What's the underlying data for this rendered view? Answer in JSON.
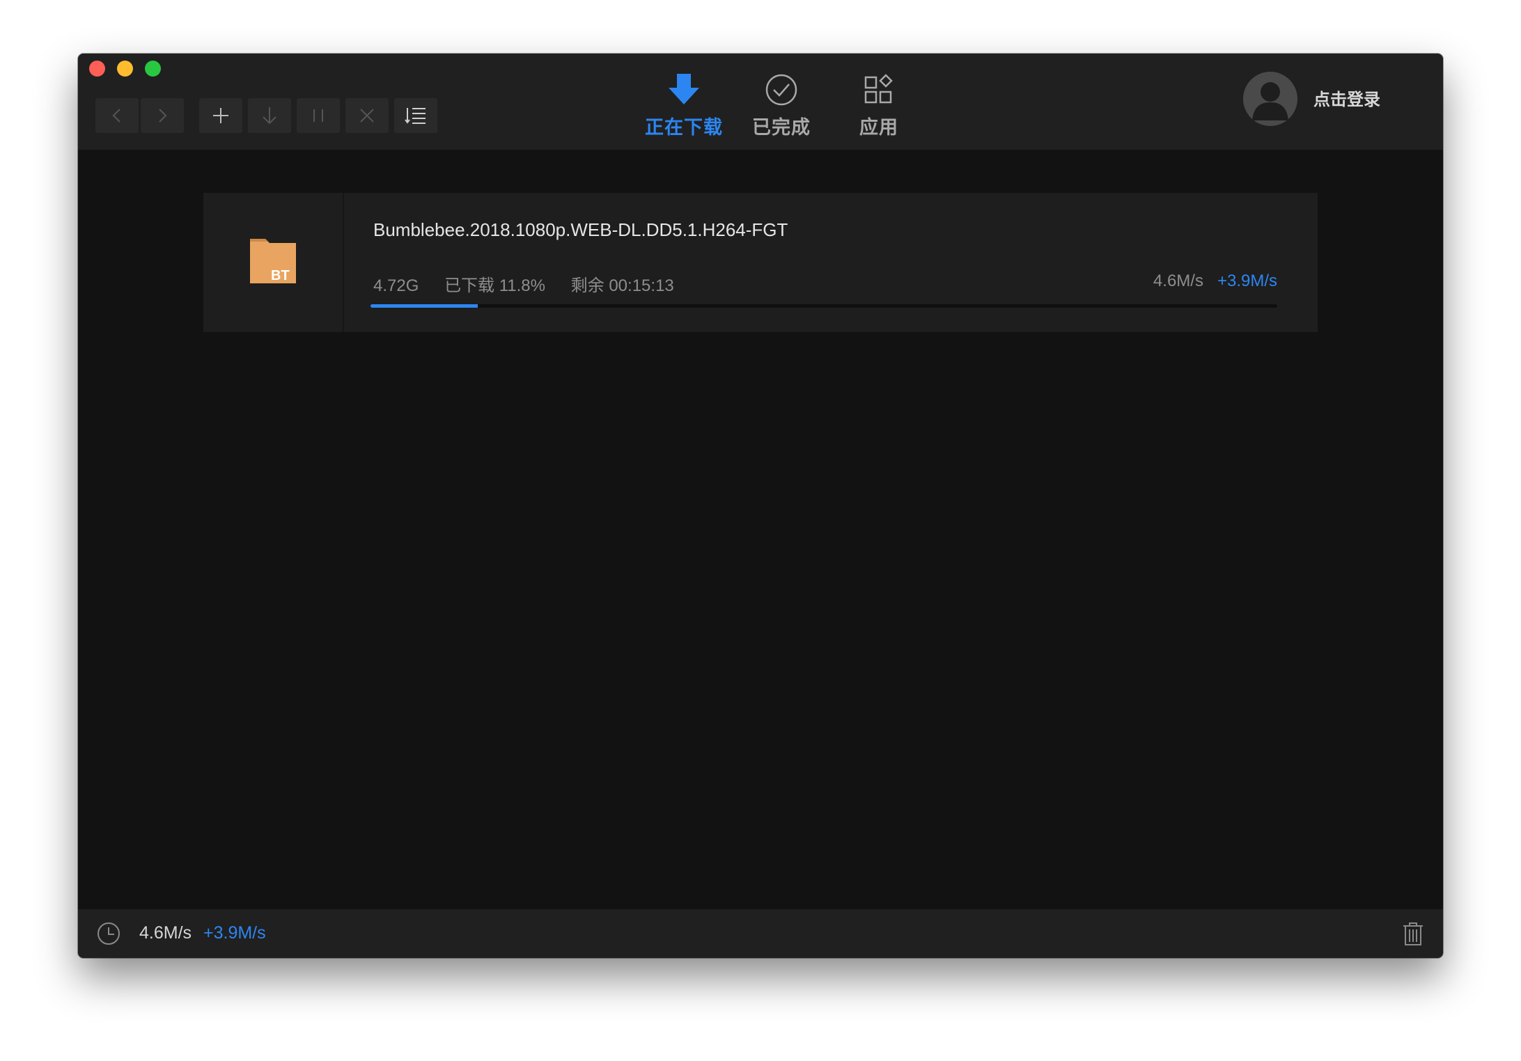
{
  "toolbar": {
    "buttons": [
      "back",
      "forward",
      "add",
      "download",
      "pause",
      "delete",
      "sort"
    ]
  },
  "tabs": [
    {
      "label": "正在下载",
      "active": true
    },
    {
      "label": "已完成",
      "active": false
    },
    {
      "label": "应用",
      "active": false
    }
  ],
  "user": {
    "login_label": "点击登录"
  },
  "task": {
    "badge": "BT",
    "filename": "Bumblebee.2018.1080p.WEB-DL.DD5.1.H264-FGT",
    "size": "4.72G",
    "progress_text": "已下载 11.8%",
    "remaining": "剩余 00:15:13",
    "speed": "4.6M/s",
    "boost_speed": "+3.9M/s",
    "progress": 0.118
  },
  "status": {
    "speed": "4.6M/s",
    "boost_speed": "+3.9M/s"
  },
  "colors": {
    "accent": "#2c86f2",
    "folder": "#e8a460"
  }
}
